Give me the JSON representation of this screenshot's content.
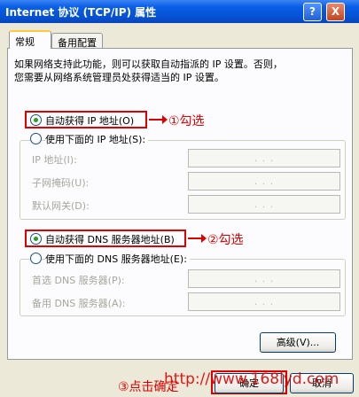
{
  "window": {
    "title": "Internet 协议 (TCP/IP) 属性",
    "help_label": "?",
    "close_label": "X"
  },
  "tabs": [
    {
      "label": "常规",
      "selected": true
    },
    {
      "label": "备用配置",
      "selected": false
    }
  ],
  "description": "如果网络支持此功能，则可以获取自动指派的 IP 设置。否则，\n您需要从网络系统管理员处获得适当的 IP 设置。",
  "ip": {
    "auto_label": "自动获得 IP 地址(O)",
    "auto_selected": true,
    "manual_label": "使用下面的 IP 地址(S):",
    "fields": [
      {
        "label": "IP 地址(I):",
        "value": ".   .   ."
      },
      {
        "label": "子网掩码(U):",
        "value": ".   .   ."
      },
      {
        "label": "默认网关(D):",
        "value": ".   .   ."
      }
    ]
  },
  "dns": {
    "auto_label": "自动获得 DNS 服务器地址(B)",
    "auto_selected": true,
    "manual_label": "使用下面的 DNS 服务器地址(E):",
    "fields": [
      {
        "label": "首选 DNS 服务器(P):",
        "value": ".   .   ."
      },
      {
        "label": "备用 DNS 服务器(A):",
        "value": ".   .   ."
      }
    ]
  },
  "advanced_label": "高级(V)...",
  "ok_label": "确定",
  "cancel_label": "取消",
  "annotations": {
    "step1": "①勾选",
    "step2": "②勾选",
    "step3": "③点击确定"
  },
  "watermark": "http://www.168lyd.com",
  "colors": {
    "annotation": "#e00000",
    "title_bar": "#0552d6",
    "radio_dot": "#21a121"
  }
}
